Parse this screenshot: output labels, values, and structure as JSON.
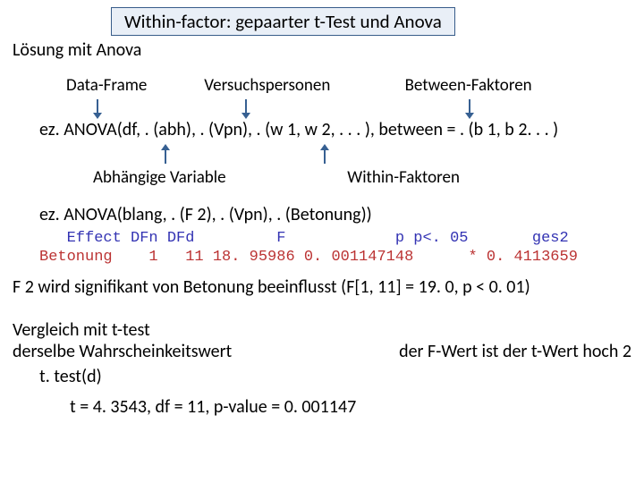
{
  "title": "Within-factor: gepaarter t-Test und Anova",
  "subtitle": "Lösung mit Anova",
  "labels_top": {
    "dataframe": "Data-Frame",
    "versuchspersonen": "Versuchspersonen",
    "between": "Between-Faktoren"
  },
  "code1": "ez. ANOVA(df, . (abh), . (Vpn), . (w 1, w 2, . . . ), between = . (b 1, b 2. . . )",
  "labels_bottom": {
    "abhvar": "Abhängige Variable",
    "within": "Within-Faktoren"
  },
  "code2": "ez. ANOVA(blang, . (F 2), . (Vpn), . (Betonung))",
  "table": {
    "header": "   Effect DFn DFd         F            p p<. 05       ges2",
    "row": "Betonung    1   11 18. 95986 0. 001147148      * 0. 4113659"
  },
  "conclusion": "F 2 wird signifikant von Betonung beeinflusst (F[1, 11] = 19. 0, p < 0. 01)",
  "compare": {
    "line1": "Vergleich mit t-test",
    "line2a": "derselbe Wahrscheinkeitswert",
    "line2b": "der F-Wert ist der t-Wert hoch 2",
    "ttest": "t. test(d)",
    "tresult": "t = 4. 3543, df = 11, p-value = 0. 001147"
  }
}
